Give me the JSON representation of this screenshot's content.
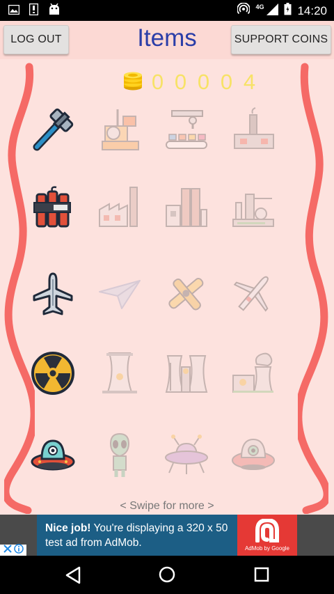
{
  "status_bar": {
    "time": "14:20",
    "network": "4G",
    "icons": [
      "gallery-icon",
      "sim-card-icon",
      "android-icon",
      "hotspot-icon",
      "signal-icon",
      "battery-icon"
    ]
  },
  "header": {
    "logout_label": "LOG OUT",
    "title": "Items",
    "support_label": "SUPPORT COINS"
  },
  "coins": {
    "icon": "coin-stack-icon",
    "digits": [
      "0",
      "0",
      "0",
      "0",
      "4"
    ]
  },
  "items": [
    {
      "name": "hammer",
      "unlocked": true
    },
    {
      "name": "saw-machine",
      "unlocked": false
    },
    {
      "name": "assembly-line",
      "unlocked": false
    },
    {
      "name": "small-factory",
      "unlocked": false
    },
    {
      "name": "dynamite",
      "unlocked": true
    },
    {
      "name": "factory-chimney",
      "unlocked": false
    },
    {
      "name": "factory-buildings",
      "unlocked": false
    },
    {
      "name": "refinery",
      "unlocked": false
    },
    {
      "name": "airplane",
      "unlocked": true
    },
    {
      "name": "paper-plane",
      "unlocked": false
    },
    {
      "name": "biplane",
      "unlocked": false
    },
    {
      "name": "jet",
      "unlocked": false
    },
    {
      "name": "radiation",
      "unlocked": true
    },
    {
      "name": "cooling-tower",
      "unlocked": false
    },
    {
      "name": "reactor-towers",
      "unlocked": false
    },
    {
      "name": "nuclear-plant",
      "unlocked": false
    },
    {
      "name": "ufo",
      "unlocked": true
    },
    {
      "name": "alien",
      "unlocked": false
    },
    {
      "name": "flying-saucer",
      "unlocked": false
    },
    {
      "name": "alien-ship",
      "unlocked": false
    }
  ],
  "swipe_hint": "<  Swipe for more  >",
  "ad": {
    "headline": "Nice job!",
    "body": "You're displaying a 320 x 50 test ad from AdMob.",
    "logo_caption": "AdMob by Google"
  },
  "nav": {
    "back": "back-icon",
    "home": "home-icon",
    "recents": "recents-icon"
  },
  "colors": {
    "background": "#fde2de",
    "wave": "#f4635f",
    "title": "#2b3ea8",
    "coin_digits": "#f7e35a",
    "ad": "#1c5e85"
  }
}
